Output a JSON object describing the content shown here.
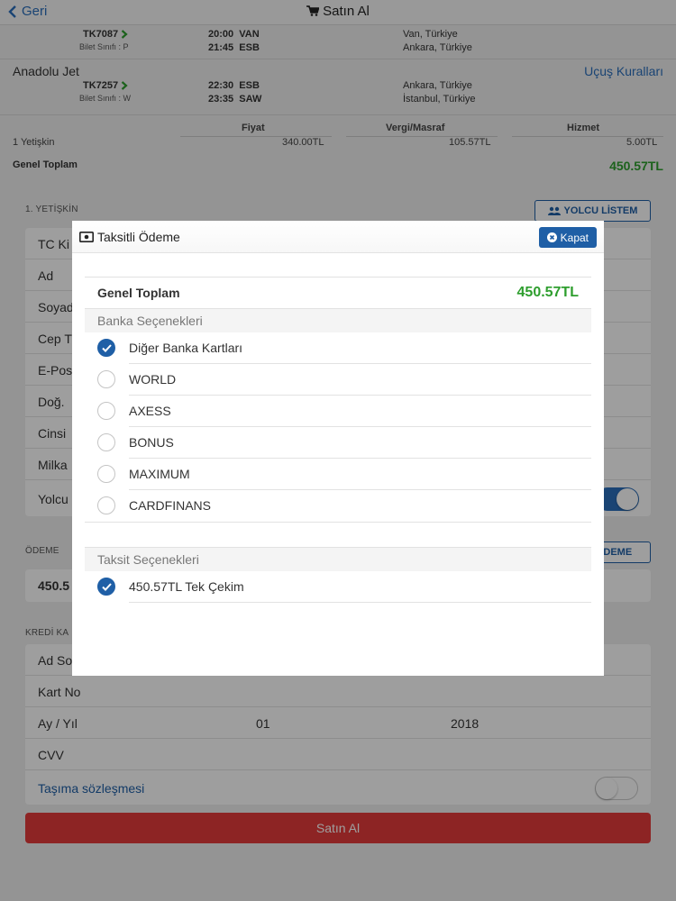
{
  "nav": {
    "back_label": "Geri",
    "title": "Satın Al"
  },
  "flights": [
    {
      "code": "TK7087",
      "class": "Bilet Sınıfı : P",
      "dep_time": "20:00",
      "dep_code": "VAN",
      "arr_time": "21:45",
      "arr_code": "ESB",
      "dep_city": "Van, Türkiye",
      "arr_city": "Ankara, Türkiye"
    },
    {
      "code": "TK7257",
      "class": "Bilet Sınıfı : W",
      "dep_time": "22:30",
      "dep_code": "ESB",
      "arr_time": "23:35",
      "arr_code": "SAW",
      "dep_city": "Ankara, Türkiye",
      "arr_city": "İstanbul, Türkiye"
    }
  ],
  "airline": "Anadolu Jet",
  "rules_link": "Uçuş Kuralları",
  "fare": {
    "headers": {
      "price": "Fiyat",
      "tax": "Vergi/Masraf",
      "service": "Hizmet"
    },
    "passenger": "1 Yetişkin",
    "price": "340.00TL",
    "tax": "105.57TL",
    "service": "5.00TL",
    "total_label": "Genel Toplam",
    "total_value": "450.57TL"
  },
  "passenger_section": {
    "label": "1. YETİŞKİN",
    "list_button": "YOLCU LİSTEM",
    "fields": [
      "TC Ki",
      "Ad",
      "Soyad",
      "Cep T",
      "E-Pos",
      "Doğ.",
      "Cinsi",
      "Milka",
      "Yolcu"
    ]
  },
  "payment_section": {
    "label": "ÖDEME",
    "button": "ÖDEME",
    "value": "450.5"
  },
  "card_section": {
    "label": "KREDİ KA",
    "fields": {
      "name": "Ad So",
      "card_no": "Kart No",
      "expiry_label": "Ay / Yıl",
      "month": "01",
      "year": "2018",
      "cvv": "CVV",
      "contract": "Taşıma sözleşmesi"
    }
  },
  "buy_button": "Satın Al",
  "modal": {
    "title": "Taksitli Ödeme",
    "close_label": "Kapat",
    "total_label": "Genel Toplam",
    "total_value": "450.57TL",
    "bank_section": "Banka Seçenekleri",
    "banks": [
      {
        "label": "Diğer Banka Kartları",
        "checked": true
      },
      {
        "label": "WORLD",
        "checked": false
      },
      {
        "label": "AXESS",
        "checked": false
      },
      {
        "label": "BONUS",
        "checked": false
      },
      {
        "label": "MAXIMUM",
        "checked": false
      },
      {
        "label": "CARDFINANS",
        "checked": false
      }
    ],
    "installment_section": "Taksit Seçenekleri",
    "installments": [
      {
        "label": "450.57TL Tek Çekim",
        "checked": true
      }
    ]
  },
  "colors": {
    "accent": "#1f5fa6",
    "link": "#2a6ebb",
    "total_green": "#2e9e2e",
    "buy_red": "#e43a3a"
  }
}
